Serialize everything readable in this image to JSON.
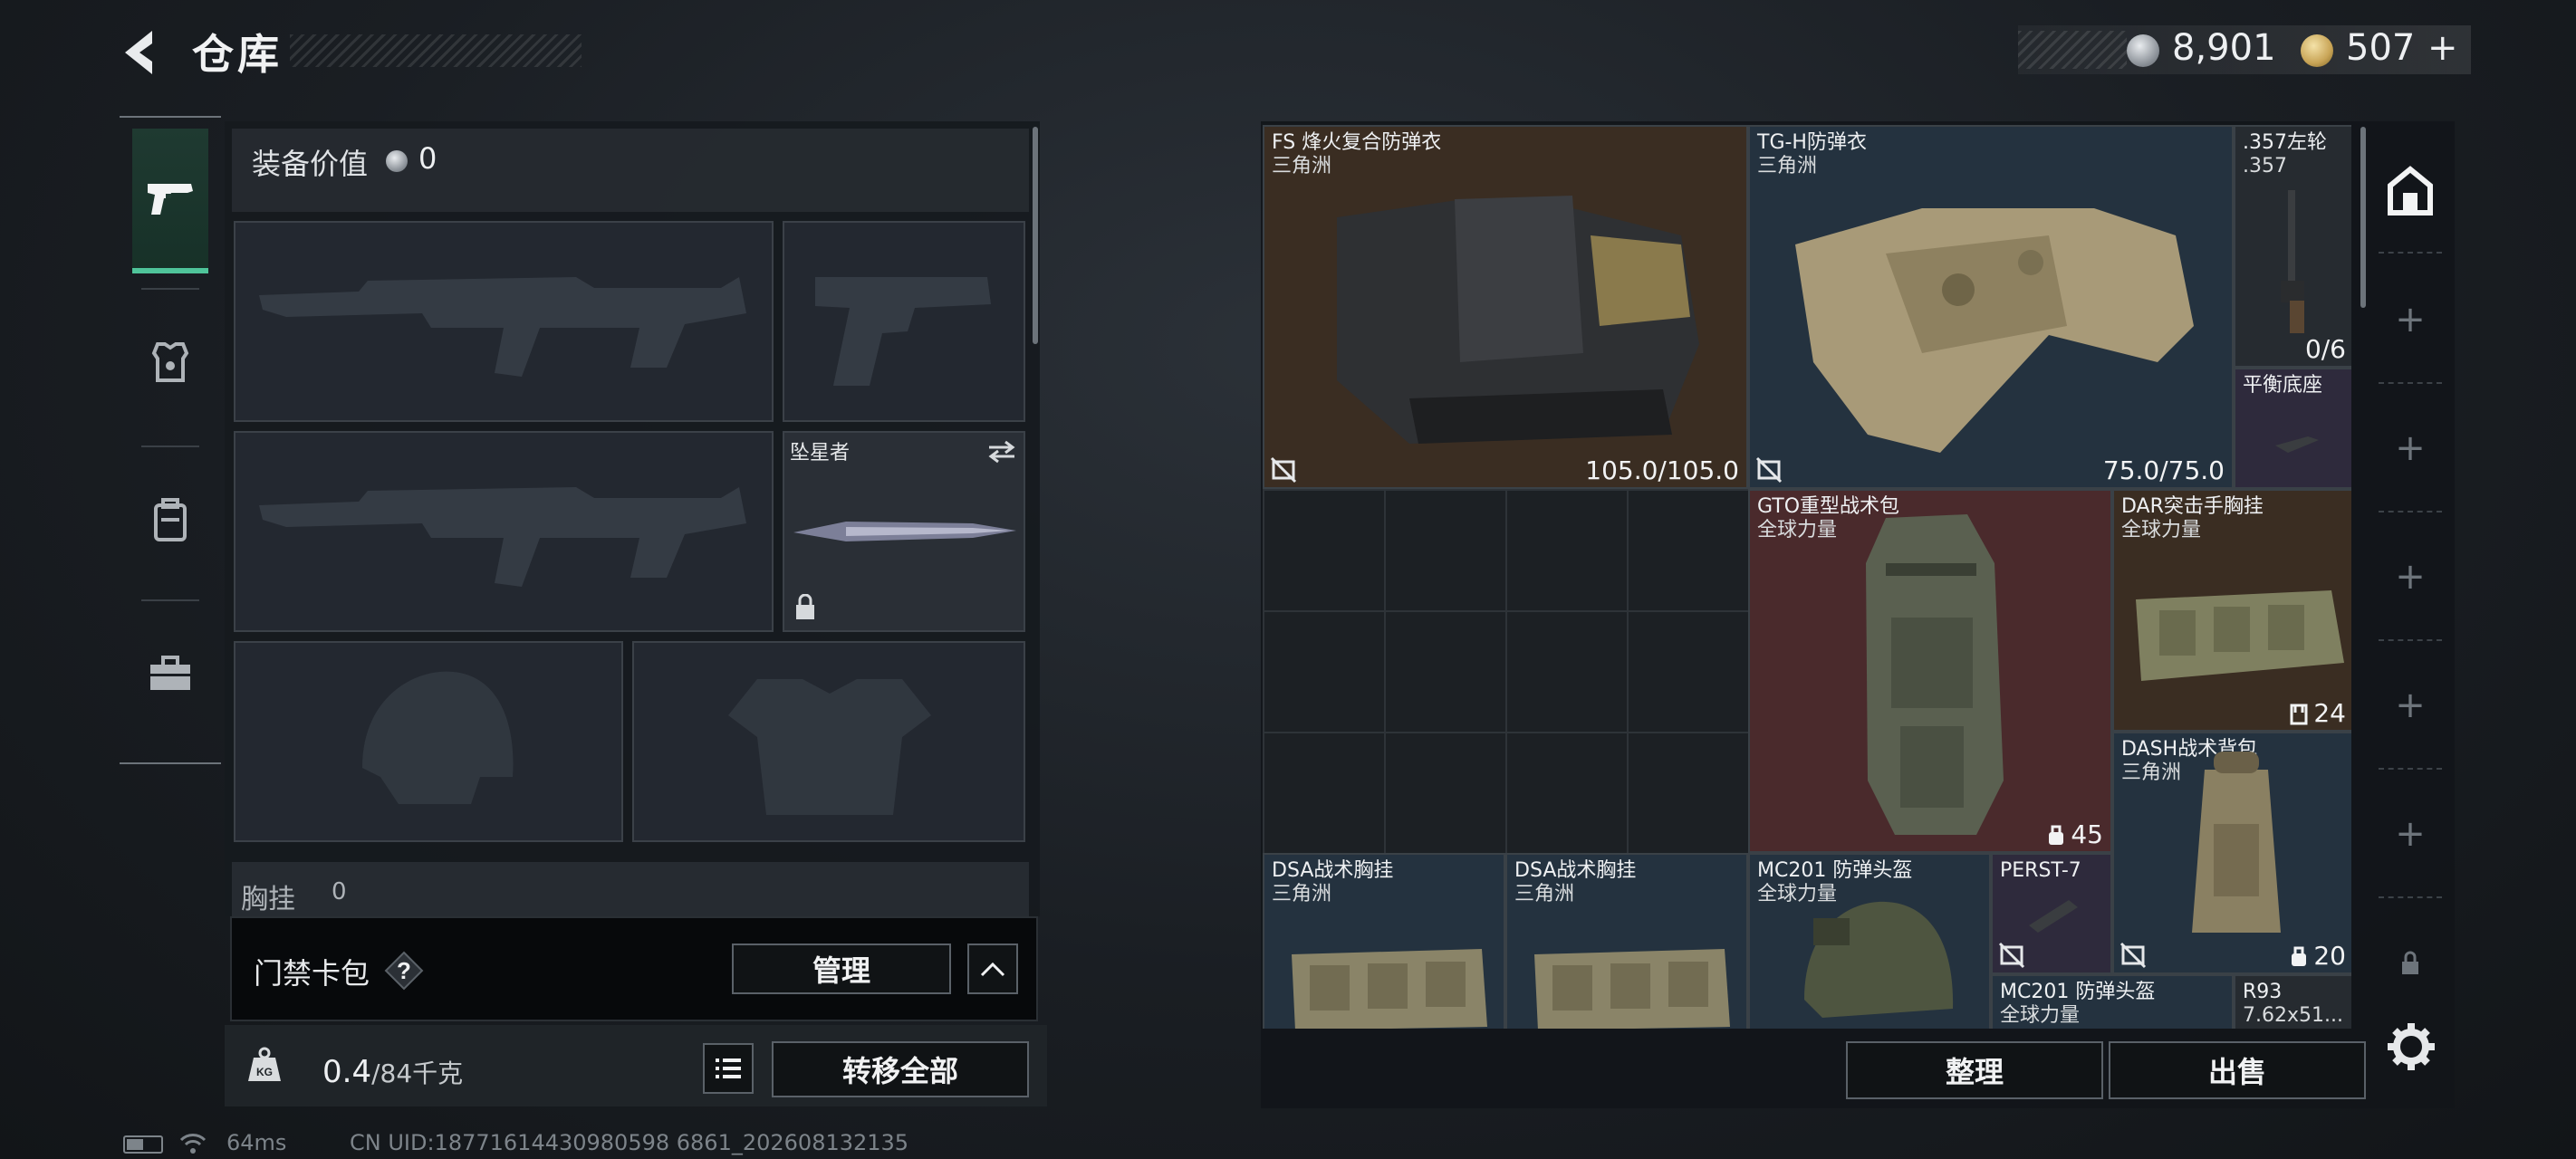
{
  "header": {
    "title": "仓库",
    "currency_silver": "8,901",
    "currency_gold": "507",
    "currency_gold_suffix": "+"
  },
  "loadout": {
    "value_label": "装备价值",
    "value_amount": "0",
    "melee_name": "坠星者",
    "drawer_label_partial": "胸挂",
    "drawer_count_partial": "0"
  },
  "keycard": {
    "label": "门禁卡包",
    "help": "?",
    "manage_label": "管理"
  },
  "weight": {
    "current": "0.4",
    "max": "/84千克",
    "transfer_label": "转移全部"
  },
  "status": {
    "ping": "64ms",
    "uid": "CN UID:18771614430980598 6861_202608132135"
  },
  "stash": {
    "items": [
      {
        "name": "FS 烽火复合防弹衣",
        "sub": "三角洲",
        "stat": "105.0/105.0"
      },
      {
        "name": "TG-H防弹衣",
        "sub": "三角洲",
        "stat": "75.0/75.0"
      },
      {
        "name": ".357左轮",
        "sub": ".357",
        "stat": "0/6"
      },
      {
        "name": "平衡底座",
        "sub": "",
        "stat": ""
      },
      {
        "name": "GTO重型战术包",
        "sub": "全球力量",
        "stat": "45"
      },
      {
        "name": "DAR突击手胸挂",
        "sub": "全球力量",
        "stat": "24"
      },
      {
        "name": "DASH战术背包",
        "sub": "三角洲",
        "stat": "20"
      },
      {
        "name": "DSA战术胸挂",
        "sub": "三角洲",
        "stat": ""
      },
      {
        "name": "DSA战术胸挂",
        "sub": "三角洲",
        "stat": ""
      },
      {
        "name": "MC201 防弹头盔",
        "sub": "全球力量",
        "stat": ""
      },
      {
        "name": "PERST-7",
        "sub": "",
        "stat": ""
      },
      {
        "name": "MC201 防弹头盔",
        "sub": "全球力量",
        "stat": ""
      },
      {
        "name": "R93",
        "sub": "7.62x51...",
        "stat": ""
      }
    ],
    "sort_label": "整理",
    "sell_label": "出售"
  },
  "colors": {
    "accent_green": "#4fc49a",
    "item_brown": "#3a2d22",
    "item_blue": "#24323f",
    "item_red": "#4a2a2c",
    "item_purple": "#2e2a3c"
  },
  "icons": {
    "tabs": [
      "pistol-icon",
      "armor-icon",
      "backpack-icon",
      "toolbox-icon"
    ],
    "rail": [
      "stash-icon",
      "plus-icon",
      "plus-icon",
      "plus-icon",
      "plus-icon",
      "plus-icon",
      "lock-icon"
    ]
  }
}
